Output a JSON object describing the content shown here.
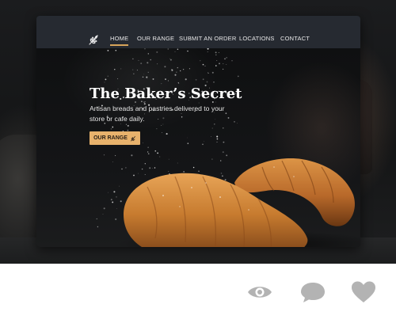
{
  "site": {
    "nav": {
      "logo_icon": "wheat-icon",
      "items": [
        {
          "label": "HOME",
          "active": true
        },
        {
          "label": "OUR RANGE",
          "active": false
        },
        {
          "label": "SUBMIT AN ORDER",
          "active": false
        },
        {
          "label": "LOCATIONS",
          "active": false
        },
        {
          "label": "CONTACT",
          "active": false
        }
      ]
    },
    "hero": {
      "title": "The Baker’s Secret",
      "subtitle": "Artisan breads and pastries delivered to your store or cafe daily.",
      "cta_label": "OUR RANGE",
      "cta_icon": "wheat-icon"
    }
  },
  "actions": {
    "view_icon": "eye-icon",
    "comment_icon": "speech-bubble-icon",
    "like_icon": "heart-icon"
  },
  "colors": {
    "nav_bg": "#262a31",
    "accent": "#e8b26c",
    "active_underline": "#d7a45a",
    "action_icon": "#b3b3b3"
  }
}
